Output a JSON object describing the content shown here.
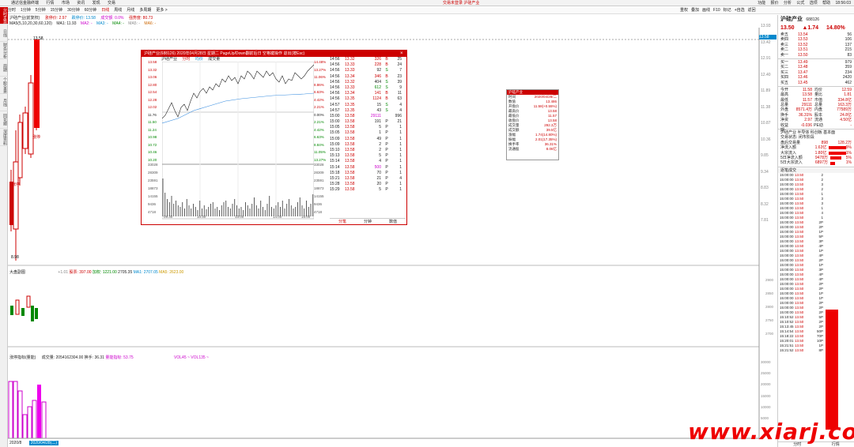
{
  "menubar": {
    "items": [
      "通达信金融终端",
      "行情",
      "市场",
      "资讯",
      "发现",
      "交易"
    ],
    "center": "交易未登录    沪硅产业",
    "right": [
      "功能",
      "报价",
      "分析",
      "公式",
      "选项",
      "帮助"
    ],
    "clock": "18:56:03"
  },
  "toolbar": {
    "items": [
      "分时",
      "1分钟",
      "5分钟",
      "15分钟",
      "30分钟",
      "60分钟",
      "日线",
      "周线",
      "月线",
      "多周期",
      "更多 >"
    ],
    "right": [
      "重权",
      "叠加",
      "画线",
      "F10",
      "标记",
      "+自选",
      "返回"
    ]
  },
  "lefttabs": [
    "分时走势",
    "日线",
    "财务分析",
    "周期",
    "个股全景",
    "月线",
    "同花顺",
    "深度资料"
  ],
  "titlebar": {
    "name": "沪硅产业(前复权)",
    "fields": [
      "涨停价: 2.97",
      "跌停价: 13.58",
      "成交额: 0.0%",
      "强势度: 80.73"
    ]
  },
  "mabar": [
    "MA5(5,10,20,30,60,120)",
    "MA1: 11.93",
    "MA2: -",
    "MA3: -",
    "MA4: -",
    "MA5: -",
    "MA6: -"
  ],
  "price_axis": [
    "13.93",
    "13.42",
    "12.91",
    "12.40",
    "11.89",
    "11.38",
    "10.87",
    "10.36",
    "9.85",
    "9.34",
    "8.83",
    "8.32",
    "7.81"
  ],
  "chart_marks": {
    "high": "13.58",
    "low": "8.98",
    "highlight": "13.58",
    "label1": "涨停",
    "label2": "涨停"
  },
  "sub1": {
    "label": "大盘副图",
    "values": [
      "+1.01",
      "股票: 397.00",
      "加权: 1221.00",
      "2705.35",
      "MA1: 2707.05",
      "MA5: 2623.00"
    ],
    "axis": [
      "2900",
      "2850",
      "2800",
      "2750",
      "2700"
    ]
  },
  "sub2": {
    "label": "涨停指标(量能)",
    "values": [
      "成交量: 2054162304.00",
      "换手: 36.31",
      "量能指标: 53.75"
    ],
    "extra": "VOL45 ~ VOL135 ~",
    "axis": [
      "30000",
      "25000",
      "20000",
      "15000",
      "10000",
      "5000"
    ]
  },
  "datebar": [
    "2020/8",
    "2020/04/28(二)"
  ],
  "popup": {
    "title": "沪硅产业(688126)  2020年04月28日  星期二  PageUp/Down翻前后日  空格键操作  退出(按Esc)",
    "sub": [
      "沪硅产业",
      "分时",
      "均价",
      "成交量"
    ],
    "yaxis_left": [
      "13.58",
      "13.32",
      "13.06",
      "12.80",
      "12.54",
      "12.28",
      "12.02",
      "11.76",
      "11.50",
      "11.24",
      "10.98",
      "10.72",
      "10.46",
      "10.20"
    ],
    "yaxis_right": [
      "14.48%",
      "13.27%",
      "11.06%",
      "8.86%",
      "6.63%",
      "4.42%",
      "2.21%",
      "0.00%",
      "2.21%",
      "4.42%",
      "6.63%",
      "8.84%",
      "11.05%",
      "13.27%"
    ],
    "vol_axis": [
      "33028",
      "28309",
      "23591",
      "18873",
      "14155",
      "9436",
      "4718"
    ],
    "time_axis": [
      "09:30",
      "10:30",
      "13:00",
      "14:00",
      "15:00"
    ],
    "footer": [
      "分笔",
      "分钟",
      "数值"
    ],
    "trades": [
      {
        "t": "14:56",
        "p": "13.32",
        "v": "326",
        "d": "B",
        "n": "25"
      },
      {
        "t": "14:56",
        "p": "13.33",
        "v": "228",
        "d": "B",
        "n": "24"
      },
      {
        "t": "14:56",
        "p": "13.33",
        "v": "92",
        "d": "S",
        "n": "7"
      },
      {
        "t": "14:56",
        "p": "13.34",
        "v": "346",
        "d": "B",
        "n": "23"
      },
      {
        "t": "14:56",
        "p": "13.32",
        "v": "404",
        "d": "S",
        "n": "39"
      },
      {
        "t": "14:56",
        "p": "13.33",
        "v": "612",
        "d": "S",
        "n": "9"
      },
      {
        "t": "14:56",
        "p": "13.34",
        "v": "141",
        "d": "B",
        "n": "11"
      },
      {
        "t": "14:56",
        "p": "13.35",
        "v": "1124",
        "d": "B",
        "n": "63"
      },
      {
        "t": "14:57",
        "p": "13.35",
        "v": "15",
        "d": "S",
        "n": "4"
      },
      {
        "t": "14:57",
        "p": "13.35",
        "v": "43",
        "d": "S",
        "n": "4"
      },
      {
        "t": "15:00",
        "p": "13.58",
        "v": "29111",
        "d": "",
        "n": "996"
      },
      {
        "t": "15:00",
        "p": "13.58",
        "v": "191",
        "d": "P",
        "n": "21"
      },
      {
        "t": "15:05",
        "p": "13.58",
        "v": "5",
        "d": "P",
        "n": "1"
      },
      {
        "t": "15:05",
        "p": "13.58",
        "v": "1",
        "d": "P",
        "n": "1"
      },
      {
        "t": "15:09",
        "p": "13.58",
        "v": "49",
        "d": "P",
        "n": "1"
      },
      {
        "t": "15:09",
        "p": "13.58",
        "v": "2",
        "d": "P",
        "n": "1"
      },
      {
        "t": "15:10",
        "p": "13.58",
        "v": "2",
        "d": "P",
        "n": "1"
      },
      {
        "t": "15:13",
        "p": "13.58",
        "v": "5",
        "d": "P",
        "n": "1"
      },
      {
        "t": "15:14",
        "p": "13.58",
        "v": "4",
        "d": "P",
        "n": "1"
      },
      {
        "t": "15:14",
        "p": "13.58",
        "v": "500",
        "d": "P",
        "n": "1"
      },
      {
        "t": "15:18",
        "p": "13.58",
        "v": "70",
        "d": "P",
        "n": "1"
      },
      {
        "t": "15:21",
        "p": "13.58",
        "v": "21",
        "d": "P",
        "n": "4"
      },
      {
        "t": "15:28",
        "p": "13.58",
        "v": "20",
        "d": "P",
        "n": "1"
      },
      {
        "t": "15:29",
        "p": "13.58",
        "v": "5",
        "d": "P",
        "n": "1"
      }
    ]
  },
  "infobox": {
    "title": "沪硅产业",
    "rows": [
      [
        "时间",
        "2020/04/28/二"
      ],
      [
        "数值",
        "13.486"
      ],
      [
        "开盘价",
        "11.58(+0.55%)"
      ],
      [
        "最高价",
        "13.58"
      ],
      [
        "最低价",
        "11.57"
      ],
      [
        "收盘价",
        "13.58"
      ],
      [
        "成交量",
        "292.3万"
      ],
      [
        "成交额",
        "39.5亿"
      ],
      [
        "涨幅",
        "1.74(14.80%)"
      ],
      [
        "振幅",
        "2.01(17.35%)"
      ],
      [
        "换手率",
        "36.31%"
      ],
      [
        "流通股",
        "8.06亿"
      ]
    ]
  },
  "right": {
    "name": "沪硅产业",
    "code": "688126",
    "price": "13.50",
    "change": "▲1.74",
    "pct": "14.80%",
    "asks": [
      [
        "卖五",
        "13.54",
        "56"
      ],
      [
        "卖四",
        "13.53",
        "106"
      ],
      [
        "卖三",
        "13.52",
        "137"
      ],
      [
        "卖二",
        "13.51",
        "215"
      ],
      [
        "卖一",
        "13.50",
        "83"
      ]
    ],
    "bids": [
      [
        "买一",
        "13.49",
        "979"
      ],
      [
        "买二",
        "13.48",
        "359"
      ],
      [
        "买三",
        "13.47",
        "234"
      ],
      [
        "买四",
        "13.46",
        "2420"
      ],
      [
        "买五",
        "13.45",
        "462"
      ]
    ],
    "stats": [
      [
        "今开",
        "11.58",
        "均价",
        "12.59"
      ],
      [
        "最高",
        "13.58",
        "量比",
        "1.81"
      ],
      [
        "最低",
        "11.57",
        "市值",
        "334.8亿"
      ],
      [
        "总量",
        "29111",
        "总量",
        "163.3万"
      ],
      [
        "外盘",
        "8571.4万",
        "内盘",
        "77589万"
      ],
      [
        "换手",
        "36.31%",
        "股本",
        "24.8亿"
      ],
      [
        "净资",
        "2.97",
        "流通",
        "4.50亿"
      ],
      [
        "收益期",
        "-0.036",
        "PE动",
        "-"
      ]
    ],
    "info_lines": [
      "沪硅产业  半导体  科创板 基本面",
      "交易状态: 闭市阶段"
    ],
    "flows": [
      [
        "盘后交易量",
        "898",
        "128.2万"
      ],
      [
        "净流入额",
        "1.63亿",
        "9%"
      ],
      [
        "大宗流入",
        "1.80亿",
        "1%"
      ],
      [
        "5日净流入额",
        "9478万",
        "5%"
      ],
      [
        "5日大宗流入",
        "6897万",
        "1%"
      ]
    ],
    "ticks_header": "逐笔成交",
    "ticks": [
      [
        "15:00:00",
        "13.50",
        "2",
        ""
      ],
      [
        "15:00:00",
        "13.50",
        "2",
        ""
      ],
      [
        "15:00:00",
        "13.50",
        "3",
        ""
      ],
      [
        "15:00:00",
        "13.50",
        "2",
        ""
      ],
      [
        "15:00:00",
        "13.50",
        "1",
        ""
      ],
      [
        "15:00:00",
        "13.50",
        "3",
        ""
      ],
      [
        "15:00:00",
        "13.50",
        "3",
        ""
      ],
      [
        "15:00:00",
        "13.50",
        "1",
        ""
      ],
      [
        "15:00:00",
        "13.50",
        "4",
        ""
      ],
      [
        "15:00:00",
        "13.50",
        "1",
        ""
      ],
      [
        "15:00:00",
        "13.50",
        "2P",
        ""
      ],
      [
        "15:00:00",
        "13.50",
        "2P",
        ""
      ],
      [
        "15:00:00",
        "13.50",
        "1P",
        ""
      ],
      [
        "15:00:00",
        "13.50",
        "5P",
        ""
      ],
      [
        "15:00:00",
        "13.50",
        "3P",
        ""
      ],
      [
        "15:00:00",
        "13.50",
        "4P",
        ""
      ],
      [
        "15:00:00",
        "13.50",
        "1P",
        ""
      ],
      [
        "15:00:00",
        "13.50",
        "4P",
        ""
      ],
      [
        "15:00:00",
        "13.50",
        "2P",
        ""
      ],
      [
        "15:00:00",
        "13.50",
        "1P",
        ""
      ],
      [
        "15:00:00",
        "13.50",
        "3P",
        ""
      ],
      [
        "15:00:00",
        "13.50",
        "4P",
        ""
      ],
      [
        "15:00:00",
        "13.50",
        "4P",
        ""
      ],
      [
        "15:00:00",
        "13.50",
        "2P",
        ""
      ],
      [
        "15:00:00",
        "13.50",
        "2P",
        ""
      ],
      [
        "15:00:00",
        "13.50",
        "1P",
        ""
      ],
      [
        "15:00:00",
        "13.50",
        "1P",
        ""
      ],
      [
        "15:00:00",
        "13.50",
        "2P",
        ""
      ],
      [
        "15:00:00",
        "13.50",
        "2P",
        ""
      ],
      [
        "15:00:00",
        "13.50",
        "2P",
        ""
      ],
      [
        "15:10:52",
        "13.50",
        "5P",
        ""
      ],
      [
        "15:10:52",
        "13.50",
        "2P",
        ""
      ],
      [
        "15:13:45",
        "13.50",
        "2P",
        ""
      ],
      [
        "15:14:54",
        "13.50",
        "50P",
        ""
      ],
      [
        "15:18:22",
        "13.50",
        "70P",
        ""
      ],
      [
        "15:20:01",
        "13.50",
        "10P",
        ""
      ],
      [
        "15:21:51",
        "13.50",
        "1P",
        ""
      ],
      [
        "15:21:52",
        "13.50",
        "8P",
        ""
      ]
    ],
    "bottom": [
      "分时",
      "行情"
    ]
  },
  "watermark": "www.xiarj.com"
}
